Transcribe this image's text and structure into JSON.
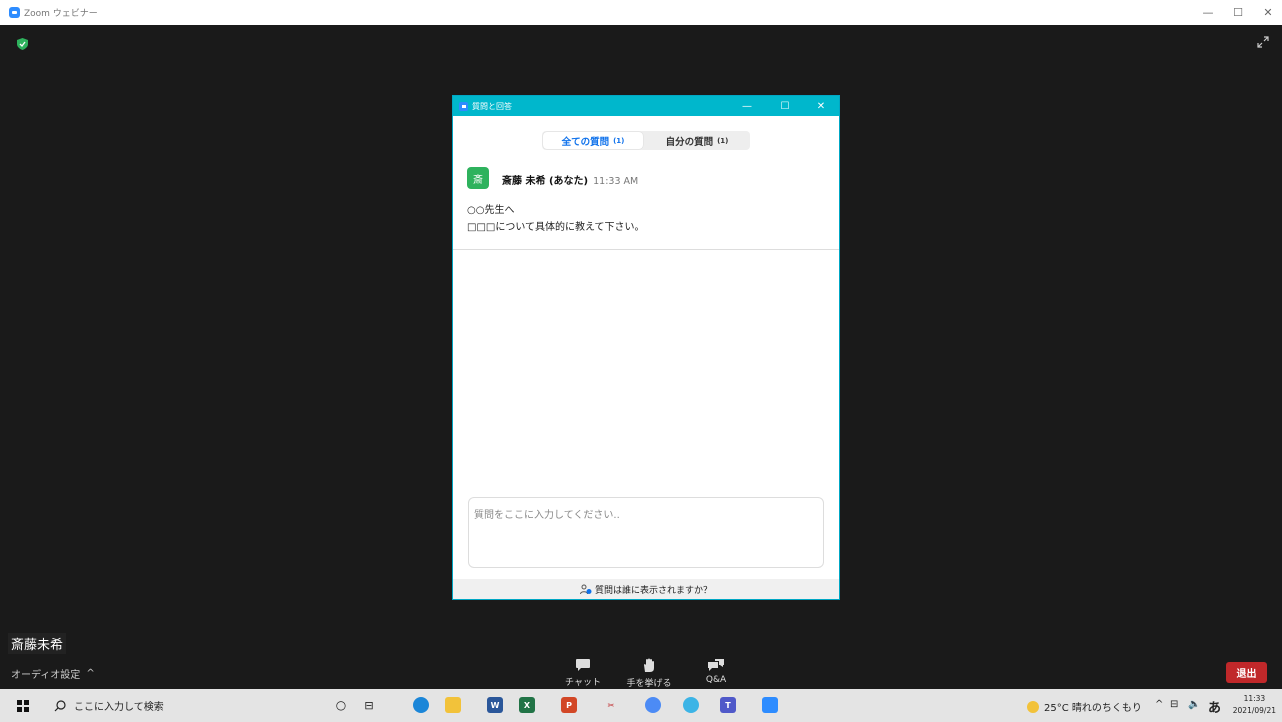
{
  "window": {
    "title": "Zoom ウェビナー",
    "minimize": "—",
    "maximize": "☐",
    "close": "✕"
  },
  "participant": {
    "name": "斎藤未希"
  },
  "controls": {
    "audio_label": "オーディオ設定",
    "audio_caret": "^",
    "chat_label": "チャット",
    "raise_hand_label": "手を挙げる",
    "qa_label": "Q&A",
    "leave_label": "退出"
  },
  "qa_dialog": {
    "title": "質問と回答",
    "tabs": [
      {
        "label": "全ての質問",
        "count": "(1)",
        "active": true
      },
      {
        "label": "自分の質問",
        "count": "(1)",
        "active": false
      }
    ],
    "question": {
      "avatar_char": "斎",
      "author": "斎藤 未希 (あなた)",
      "time": "11:33 AM",
      "lines": [
        "○○先生へ",
        "□□□について具体的に教えて下さい。"
      ]
    },
    "input_placeholder": "質問をここに入力してください..",
    "visibility_note": "質問は誰に表示されますか？"
  },
  "taskbar": {
    "search_placeholder": "ここに入力して検索",
    "weather": "25°C 晴れのちくもり",
    "ime": "あ",
    "time": "11:33",
    "date": "2021/09/21"
  },
  "colors": {
    "accent": "#00b7cc",
    "leave": "#c0282a",
    "avatar": "#2eb25d",
    "tab_active": "#0e71eb"
  }
}
